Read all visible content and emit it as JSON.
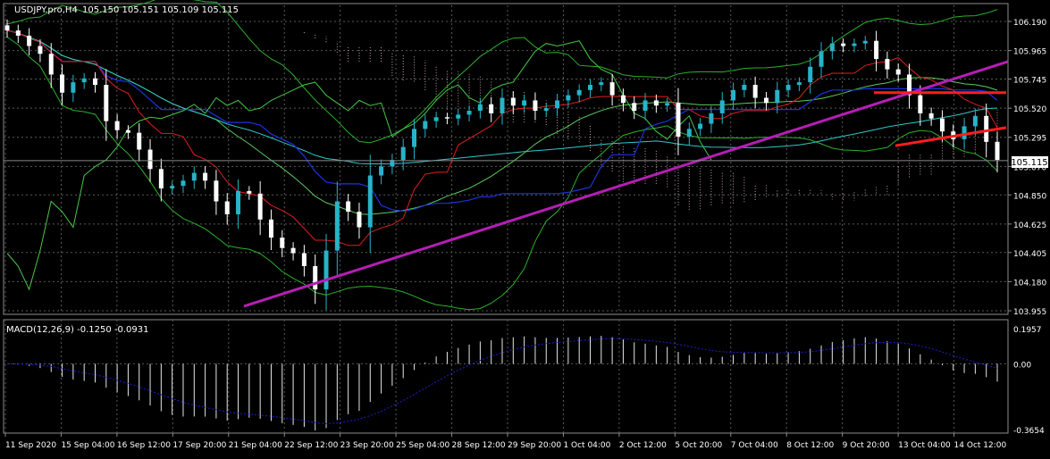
{
  "window": {
    "symbol_line": "USDJPY.pro,H4",
    "ohlc": "105.150 105.151 105.109 105.115",
    "indicator_label": "MACD(12,26,9) -0.1250 -0.0931",
    "current_price_label": "105.115"
  },
  "colors": {
    "background": "#000000",
    "grid": "#5a5a5a",
    "frame": "#8c8c8c",
    "axis_text": "#ffffff",
    "bull_candle": "#26b4c8",
    "bear_candle": "#ffffff",
    "trendline": "#b41eb4",
    "channel": "#ff1e1e",
    "bollinger": "#2db02d",
    "envelope": "#5cc85c",
    "tenkan": "#e01e1e",
    "kijun": "#1e32dc",
    "chikou": "#46c846",
    "ma_slow": "#32c8c8",
    "senkou": "#c8a0a0",
    "macd_line": "#1e1ecc",
    "histogram": "#e6e6e6"
  },
  "chart_data": [
    {
      "type": "candlestick",
      "title": "USDJPY.pro,H4",
      "ylim": [
        103.955,
        106.19
      ],
      "price_ticks": [
        "106.190",
        "105.965",
        "105.745",
        "105.520",
        "105.295",
        "105.070",
        "104.850",
        "104.625",
        "104.405",
        "104.180",
        "103.955"
      ],
      "time_labels": [
        "11 Sep 2020",
        "15 Sep 04:00",
        "16 Sep 12:00",
        "17 Sep 20:00",
        "21 Sep 04:00",
        "22 Sep 12:00",
        "23 Sep 20:00",
        "25 Sep 04:00",
        "28 Sep 12:00",
        "29 Sep 20:00",
        "1 Oct 04:00",
        "2 Oct 12:00",
        "5 Oct 20:00",
        "7 Oct 04:00",
        "8 Oct 12:00",
        "9 Oct 20:00",
        "13 Oct 04:00",
        "14 Oct 12:00"
      ],
      "bars": 91,
      "close": [
        106.12,
        106.08,
        106.0,
        105.94,
        105.78,
        105.64,
        105.72,
        105.75,
        105.7,
        105.42,
        105.35,
        105.33,
        105.2,
        105.05,
        104.9,
        104.92,
        104.96,
        105.02,
        104.96,
        104.8,
        104.7,
        104.88,
        104.86,
        104.66,
        104.52,
        104.44,
        104.4,
        104.3,
        104.12,
        104.42,
        104.8,
        104.72,
        104.6,
        105.0,
        105.07,
        105.12,
        105.22,
        105.36,
        105.42,
        105.45,
        105.44,
        105.47,
        105.5,
        105.55,
        105.48,
        105.6,
        105.54,
        105.58,
        105.5,
        105.52,
        105.58,
        105.62,
        105.66,
        105.7,
        105.72,
        105.62,
        105.56,
        105.5,
        105.58,
        105.54,
        105.56,
        105.3,
        105.36,
        105.4,
        105.48,
        105.58,
        105.66,
        105.7,
        105.6,
        105.56,
        105.66,
        105.7,
        105.72,
        105.84,
        105.96,
        106.02,
        106.0,
        106.02,
        106.04,
        105.9,
        105.82,
        105.78,
        105.62,
        105.48,
        105.44,
        105.34,
        105.28,
        105.38,
        105.46,
        105.26,
        105.12
      ],
      "trendline": [
        {
          "time": "21 Sep 04:00",
          "price": 103.99
        },
        {
          "time": "14 Oct 12:00",
          "price": 105.88
        }
      ],
      "channel_upper": [
        {
          "time": "9 Oct 20:00",
          "price": 105.64
        },
        {
          "time": "14 Oct 12:00",
          "price": 105.64
        }
      ],
      "channel_lower": [
        {
          "time": "9 Oct 20:00",
          "price": 105.23
        },
        {
          "time": "14 Oct 12:00",
          "price": 105.37
        }
      ],
      "current_price": 105.115
    },
    {
      "type": "histogram",
      "title": "MACD(12,26,9)",
      "ylim": [
        -0.3654,
        0.1957
      ],
      "ticks": [
        "0.1957",
        "0.00",
        "-0.3654"
      ],
      "macd_value": -0.125,
      "signal_value": -0.0931
    }
  ]
}
